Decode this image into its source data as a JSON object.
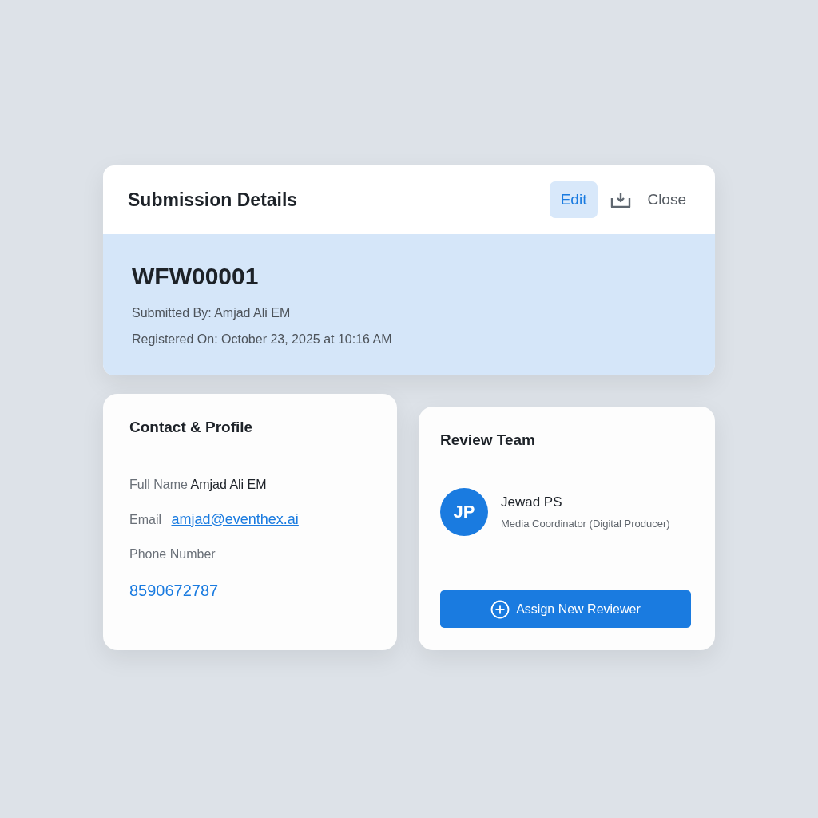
{
  "header": {
    "title": "Submission Details",
    "actions": [
      {
        "kind": "primary",
        "label": "Edit"
      },
      {
        "kind": "icon"
      },
      {
        "kind": "text",
        "label": "Close"
      }
    ]
  },
  "submission": {
    "id": "WFW00001",
    "submitted_by": "Submitted By: Amjad Ali EM",
    "registered_on": "Registered On: October 23, 2025 at 10:16 AM"
  },
  "contact": {
    "title": "Contact & Profile",
    "fields": [
      {
        "kind": "inline",
        "label": "Full Name",
        "value": "Amjad Ali EM"
      },
      {
        "kind": "link",
        "label": "Email",
        "value": "amjad@eventhex.ai"
      },
      {
        "kind": "stacked",
        "label": "Phone Number",
        "value": "8590672787"
      }
    ]
  },
  "review_team": {
    "title": "Review Team",
    "members": [
      {
        "initials": "JP",
        "name": "Jewad PS",
        "role": "Media Coordinator (Digital Producer)"
      }
    ],
    "button": "Assign New Reviewer"
  }
}
